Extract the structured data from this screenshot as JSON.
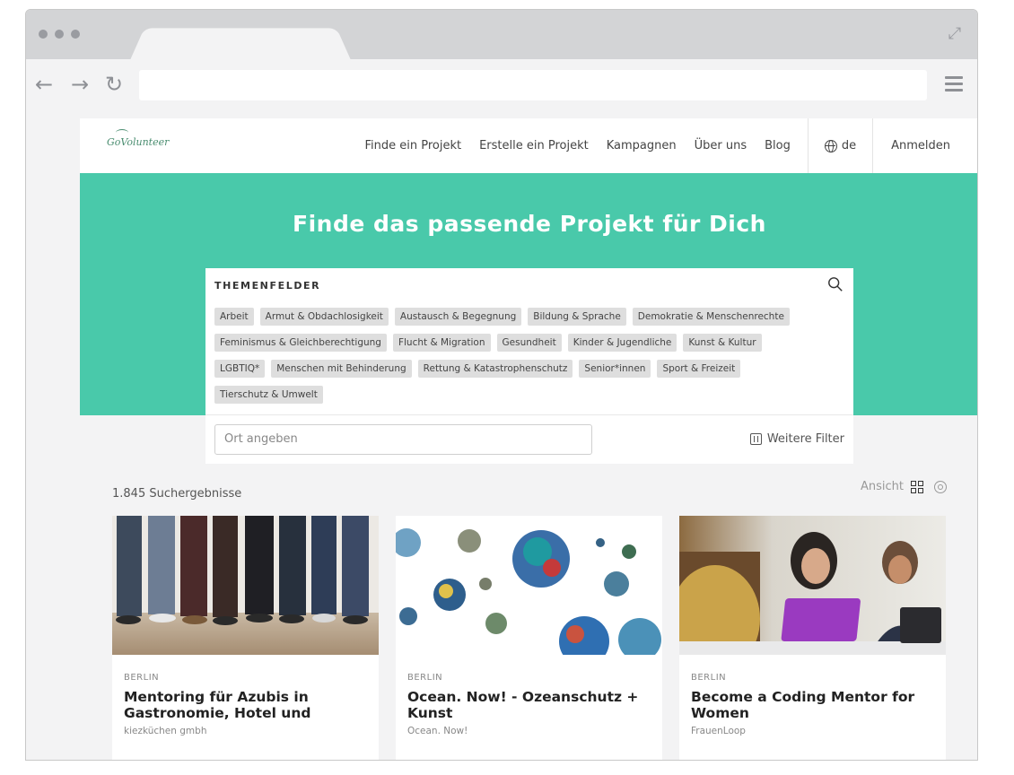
{
  "site": {
    "logo_text": "GoVolunteer",
    "nav": {
      "find_project": "Finde ein Projekt",
      "create_project": "Erstelle ein Projekt",
      "campaigns": "Kampagnen",
      "about": "Über uns",
      "blog": "Blog",
      "language": "de",
      "login": "Anmelden"
    }
  },
  "hero": {
    "title": "Finde das passende Projekt für Dich"
  },
  "filters": {
    "section_label": "THEMENFELDER",
    "topics": [
      [
        "Arbeit",
        "Armut & Obdachlosigkeit",
        "Austausch & Begegnung",
        "Bildung & Sprache",
        "Demokratie & Menschenrechte"
      ],
      [
        "Feminismus & Gleichberechtigung",
        "Flucht & Migration",
        "Gesundheit",
        "Kinder & Jugendliche",
        "Kunst & Kultur"
      ],
      [
        "LGBTIQ*",
        "Menschen mit Behinderung",
        "Rettung & Katastrophenschutz",
        "Senior*innen",
        "Sport & Freizeit"
      ],
      [
        "Tierschutz & Umwelt"
      ]
    ],
    "location_placeholder": "Ort angeben",
    "more_filters": "Weitere Filter"
  },
  "results": {
    "count_text": "1.845 Suchergebnisse",
    "view_label": "Ansicht"
  },
  "cards": [
    {
      "city": "BERLIN",
      "title": "Mentoring für Azubis in Gastronomie, Hotel und",
      "org": "kiezküchen gmbh",
      "image": "people-legs-photo"
    },
    {
      "city": "BERLIN",
      "title": "Ocean. Now! - Ozeanschutz + Kunst",
      "org": "Ocean. Now!",
      "image": "plastic-mosaic-spheres"
    },
    {
      "city": "BERLIN",
      "title": "Become a Coding Mentor for Women",
      "org": "FrauenLoop",
      "image": "laptop-meeting-photo"
    }
  ],
  "colors": {
    "brand_green": "#49c9aa",
    "chip_bg": "#dedede"
  }
}
